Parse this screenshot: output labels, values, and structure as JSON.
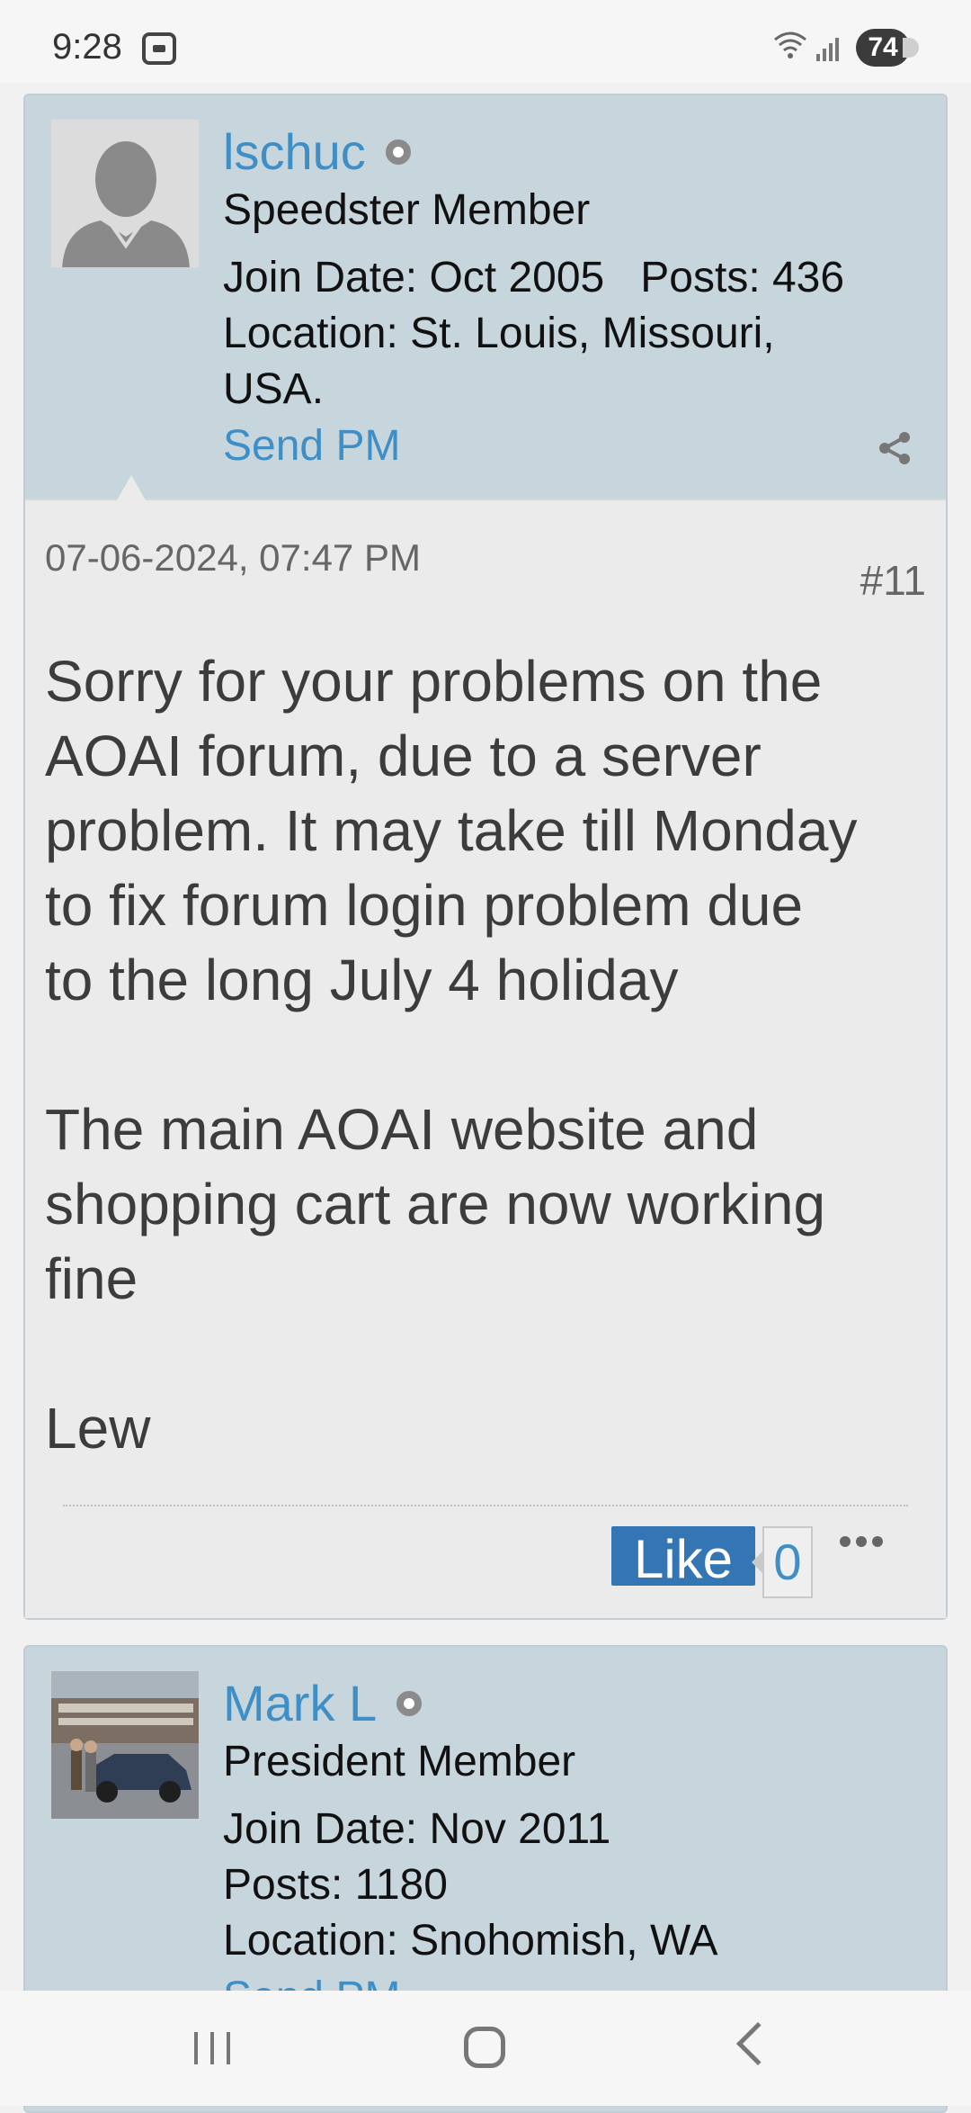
{
  "status_bar": {
    "time": "9:28",
    "battery": "74"
  },
  "posts": [
    {
      "username": "lschuc",
      "member_title": "Speedster Member",
      "join_date": "Join Date: Oct 2005",
      "posts_count": "Posts: 436",
      "location_line1": "Location: St. Louis, Missouri,",
      "location_line2": "USA.",
      "send_pm": "Send PM",
      "date": "07-06-2024, 07:47 PM",
      "number": "#11",
      "text": "Sorry for your problems on the\nAOAI forum, due to a server\nproblem. It may take till Monday\nto fix forum login problem due\nto the long July 4 holiday\n\nThe main AOAI website and\nshopping cart are now working\nfine\n\nLew",
      "like_label": "Like",
      "like_count": "0"
    },
    {
      "username": "Mark L",
      "member_title": "President Member",
      "join_date": "Join Date: Nov 2011",
      "posts_count": "Posts: 1180",
      "location_line1": "Location: Snohomish, WA",
      "send_pm": "Send PM"
    }
  ],
  "colors": {
    "link": "#3f8fc6",
    "userinfo_bg": "#c7d6dd",
    "post_bg": "#ebebeb",
    "like_bg": "#3476b3"
  }
}
